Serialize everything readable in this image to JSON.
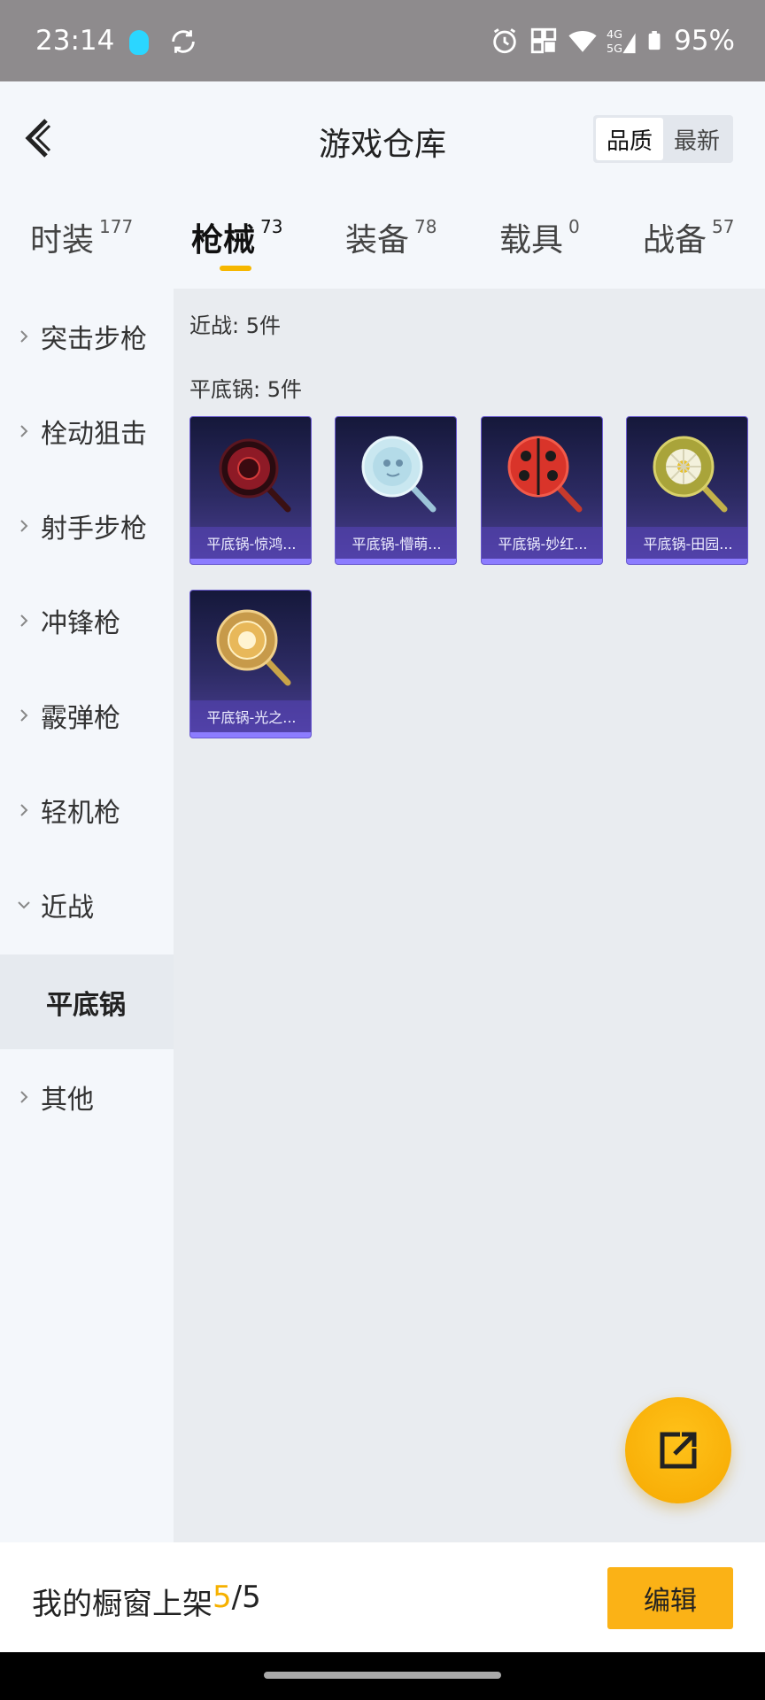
{
  "status_bar": {
    "time": "23:14",
    "battery": "95%"
  },
  "header": {
    "title": "游戏仓库",
    "sort_options": [
      "品质",
      "最新"
    ],
    "selected_sort": "品质"
  },
  "tabs": [
    {
      "label": "时装",
      "count": "177"
    },
    {
      "label": "枪械",
      "count": "73",
      "active": true
    },
    {
      "label": "装备",
      "count": "78"
    },
    {
      "label": "载具",
      "count": "0"
    },
    {
      "label": "战备",
      "count": "57"
    }
  ],
  "sidenav": {
    "items": [
      "突击步枪",
      "栓动狙击",
      "射手步枪",
      "冲锋枪",
      "霰弹枪",
      "轻机枪",
      "近战"
    ],
    "subitem": "平底锅",
    "last_item": "其他"
  },
  "content": {
    "group_heading": "近战: 5件",
    "subgroup_heading": "平底锅: 5件",
    "items": [
      {
        "label": "平底锅-惊鸿...",
        "icon": "pan-dragon-red"
      },
      {
        "label": "平底锅-懵萌...",
        "icon": "pan-light-blue"
      },
      {
        "label": "平底锅-妙红...",
        "icon": "pan-ladybug"
      },
      {
        "label": "平底锅-田园...",
        "icon": "pan-daisy"
      },
      {
        "label": "平底锅-光之...",
        "icon": "pan-golden"
      }
    ]
  },
  "footer": {
    "prefix": "我的橱窗上架 ",
    "current": "5",
    "total": "/5",
    "edit_label": "编辑"
  },
  "colors": {
    "accent": "#f6b700",
    "card_bg": "#2d2b64"
  }
}
